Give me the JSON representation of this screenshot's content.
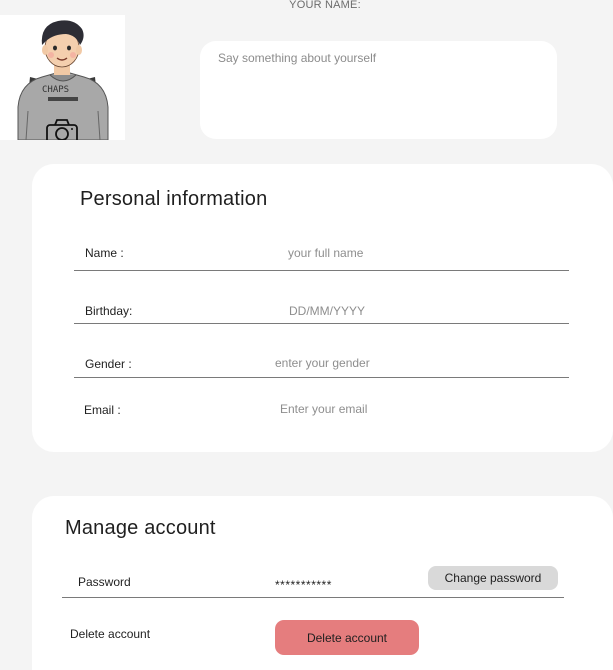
{
  "profile": {
    "name_label": "YOUR NAME:",
    "bio_placeholder": "Say something about yourself",
    "avatar_icon": "camera-icon"
  },
  "personal": {
    "title": "Personal information",
    "fields": {
      "name": {
        "label": "Name :",
        "placeholder": "your full name"
      },
      "birthday": {
        "label": "Birthday:",
        "placeholder": "DD/MM/YYYY"
      },
      "gender": {
        "label": "Gender :",
        "placeholder": "enter your gender"
      },
      "email": {
        "label": "Email :",
        "placeholder": "Enter your email"
      }
    }
  },
  "manage": {
    "title": "Manage account",
    "password_label": "Password",
    "password_value": "***********",
    "change_password_label": "Change password",
    "delete_account_label": "Delete account",
    "delete_button_label": "Delete account"
  },
  "colors": {
    "background": "#f4f4f4",
    "card": "#ffffff",
    "change_button": "#d9d9d9",
    "delete_button": "#e57d7e"
  }
}
